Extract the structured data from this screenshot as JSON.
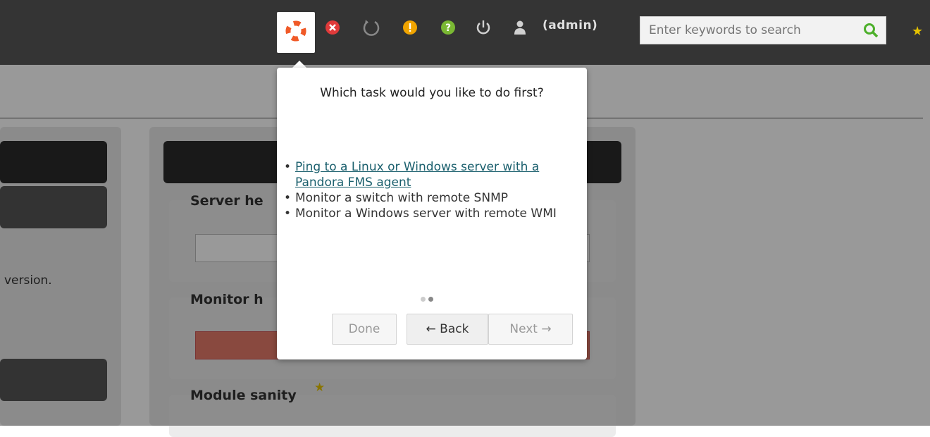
{
  "topbar": {
    "user_label": "(admin)",
    "search_placeholder": "Enter keywords to search",
    "icons": [
      "help-lifebuoy-icon",
      "error-icon",
      "refresh-icon",
      "warning-icon",
      "question-icon",
      "power-icon",
      "user-icon",
      "search-icon",
      "star-icon"
    ]
  },
  "background": {
    "left_text": "version.",
    "sections": {
      "server_health": "Server he",
      "monitor_health": "Monitor h",
      "module_sanity": "Module sanity"
    }
  },
  "wizard": {
    "title": "Which task would you like to do first?",
    "tasks": [
      {
        "label": "Ping to a Linux or Windows server with a Pandora FMS agent",
        "is_link": true
      },
      {
        "label": "Monitor a switch with remote SNMP",
        "is_link": false
      },
      {
        "label": "Monitor a Windows server with remote WMI",
        "is_link": false
      }
    ],
    "buttons": {
      "done": "Done",
      "back": "← Back",
      "next": "Next →"
    }
  },
  "colors": {
    "topbar": "#343434",
    "link": "#1a5f6d",
    "help_icon": "#f05a28",
    "star": "#e5c200",
    "search_icon": "#4caf2a"
  }
}
